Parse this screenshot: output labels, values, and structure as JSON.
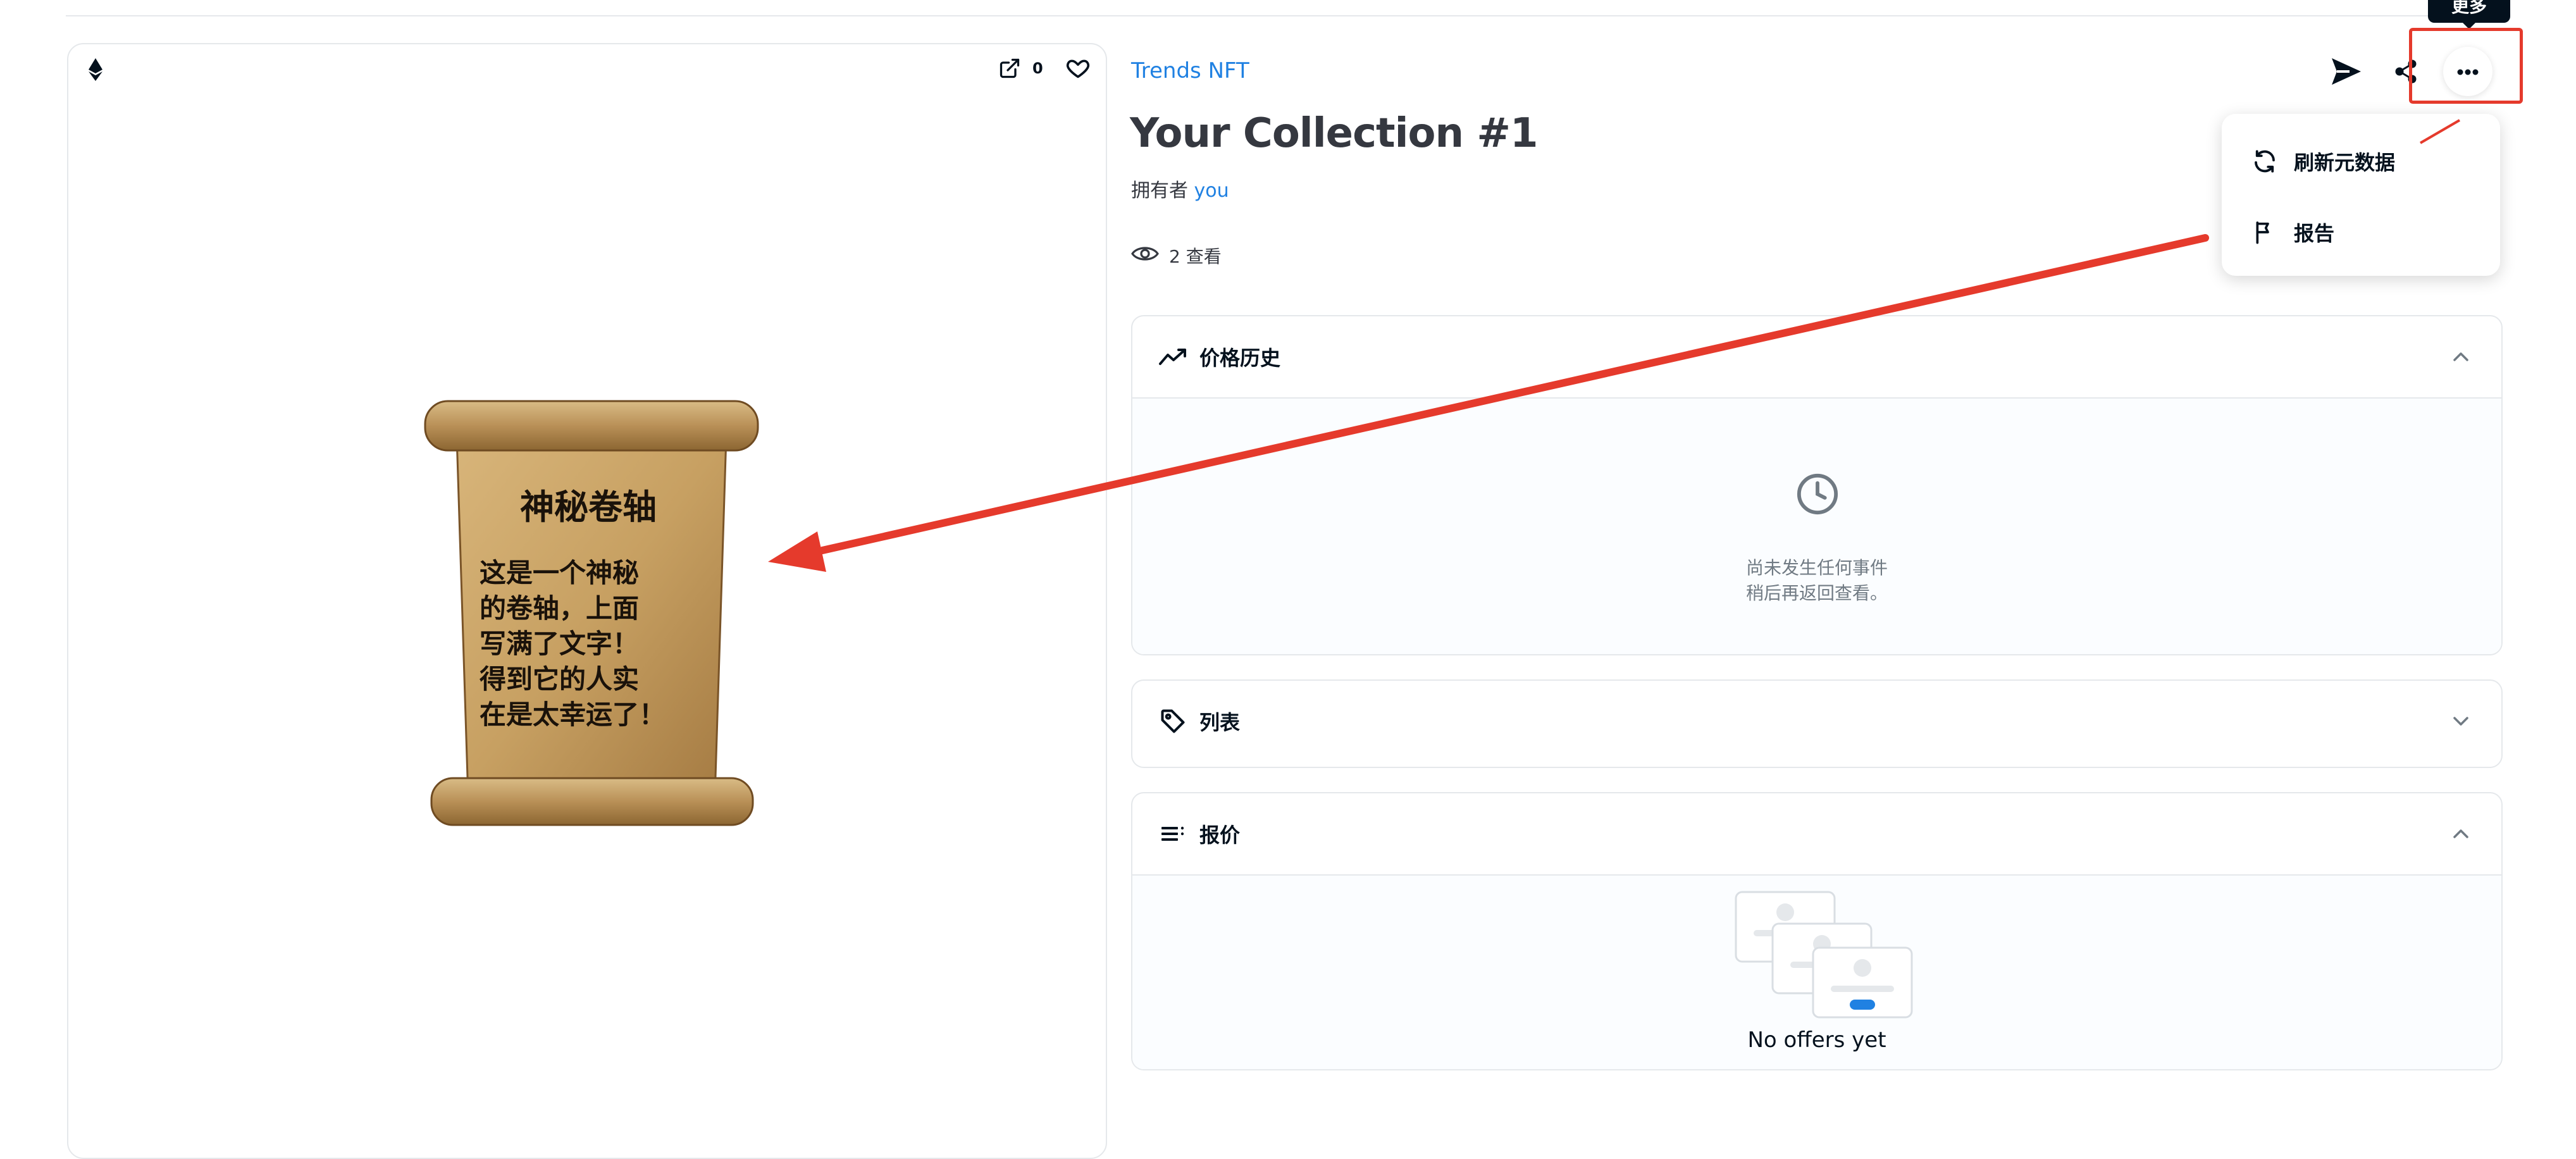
{
  "header": {
    "divider": true
  },
  "media": {
    "favorites_count": "0",
    "scroll": {
      "title": "神秘卷轴",
      "lines": [
        "这是一个神秘",
        "的卷轴，上面",
        "写满了文字！",
        "得到它的人实",
        "在是太幸运了！"
      ]
    }
  },
  "item": {
    "collection": "Trends NFT",
    "title": "Your Collection #1",
    "owner_label": "拥有者",
    "owner_name": "you",
    "views": "2 查看"
  },
  "toolbar": {
    "tooltip": "更多",
    "send_icon": "send-icon",
    "share_icon": "share-icon",
    "more_icon": "more-icon"
  },
  "menu": {
    "items": [
      {
        "label": "刷新元数据",
        "icon": "refresh-icon"
      },
      {
        "label": "报告",
        "icon": "flag-icon"
      }
    ]
  },
  "panels": {
    "price_history": {
      "label": "价格历史",
      "empty_line1": "尚未发生任何事件",
      "empty_line2": "稍后再返回查看。"
    },
    "listings": {
      "label": "列表"
    },
    "offers": {
      "label": "报价",
      "empty": "No offers yet"
    }
  },
  "colors": {
    "accent": "#2081e2",
    "annotation": "#e53a2c",
    "text": "#04111d",
    "border": "#e5e8eb"
  }
}
